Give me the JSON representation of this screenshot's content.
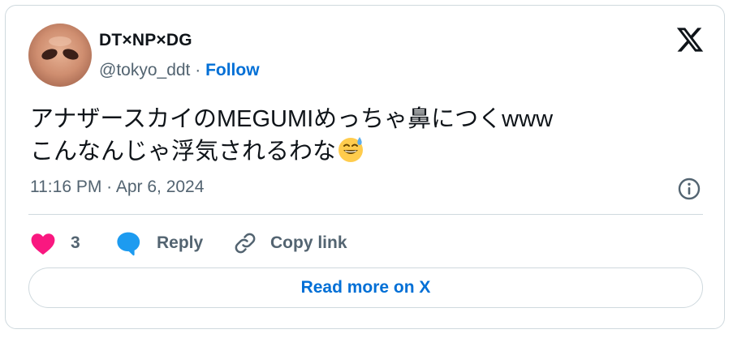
{
  "author": {
    "display_name": "DT×NP×DG",
    "handle": "@tokyo_ddt",
    "separator": " · ",
    "follow_label": "Follow"
  },
  "tweet": {
    "line1": "アナザースカイのMEGUMIめっちゃ鼻につくwww",
    "line2": "こんなんじゃ浮気されるわな",
    "emoji": "grinning-face-with-sweat-icon",
    "timestamp": "11:16 PM · Apr 6, 2024"
  },
  "actions": {
    "like_count": "3",
    "reply_label": "Reply",
    "copy_link_label": "Copy link"
  },
  "read_more_label": "Read more on X",
  "colors": {
    "like": "#f91880",
    "reply": "#1d9bf0",
    "link": "#006fd6",
    "muted": "#536471",
    "border": "#cfd9de"
  }
}
